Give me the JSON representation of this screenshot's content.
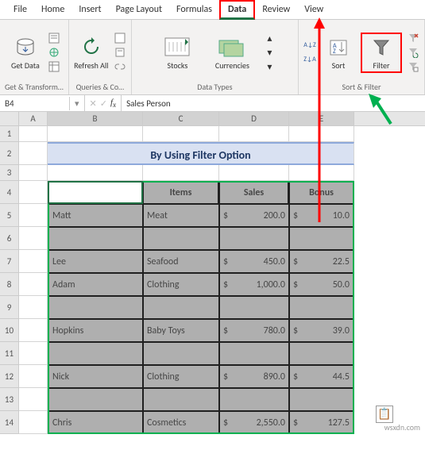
{
  "menu": {
    "items": [
      "File",
      "Home",
      "Insert",
      "Page Layout",
      "Formulas",
      "Data",
      "Review",
      "View"
    ],
    "active": "Data"
  },
  "ribbon": {
    "get_data": "Get\nData",
    "get_transform": "Get & Transform…",
    "refresh": "Refresh\nAll",
    "queries": "Queries & Co…",
    "stocks": "Stocks",
    "currencies": "Currencies",
    "data_types": "Data Types",
    "sort_az": "A→Z",
    "sort_za": "Z→A",
    "sort": "Sort",
    "filter": "Filter",
    "sort_filter": "Sort & Filter"
  },
  "formula_bar": {
    "ref": "B4",
    "value": "Sales Person"
  },
  "columns": [
    "A",
    "B",
    "C",
    "D",
    "E"
  ],
  "title": "By Using Filter Option",
  "table": {
    "headers": [
      "Sales Person",
      "Items",
      "Sales",
      "Bonus"
    ],
    "rows": [
      {
        "person": "Matt",
        "item": "Meat",
        "sales": "200.0",
        "bonus": "10.0"
      },
      {
        "person": "",
        "item": "",
        "sales": "",
        "bonus": ""
      },
      {
        "person": "Lee",
        "item": "Seafood",
        "sales": "450.0",
        "bonus": "22.5"
      },
      {
        "person": "Adam",
        "item": "Clothing",
        "sales": "1,000.0",
        "bonus": "50.0"
      },
      {
        "person": "",
        "item": "",
        "sales": "",
        "bonus": ""
      },
      {
        "person": "Hopkins",
        "item": "Baby Toys",
        "sales": "780.0",
        "bonus": "39.0"
      },
      {
        "person": "",
        "item": "",
        "sales": "",
        "bonus": ""
      },
      {
        "person": "Nick",
        "item": "Clothing",
        "sales": "890.0",
        "bonus": "44.5"
      },
      {
        "person": "",
        "item": "",
        "sales": "",
        "bonus": ""
      },
      {
        "person": "Chris",
        "item": "Cosmetics",
        "sales": "2,550.0",
        "bonus": "127.5"
      }
    ]
  },
  "watermark": "wsxdn.com"
}
